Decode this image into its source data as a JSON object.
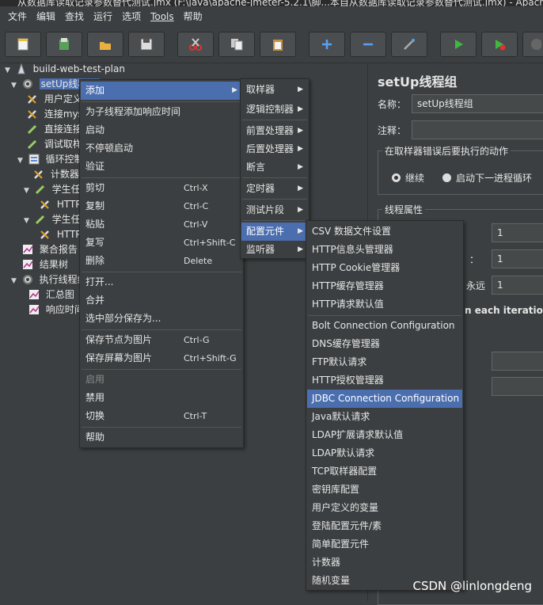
{
  "window": {
    "title": "从数据库读取记录参数替代测试.jmx (F:\\java\\apache-jmeter-5.2.1\\脚...本自从数据库读取记录参数替代测试.jmx) - Apache"
  },
  "menubar": [
    "文件",
    "编辑",
    "查找",
    "运行",
    "选项",
    "Tools",
    "帮助"
  ],
  "toolbar_icons": [
    "new-icon",
    "templates-icon",
    "open-icon",
    "save-icon",
    "cut-icon",
    "copy-icon",
    "paste-icon",
    "expand-icon",
    "collapse-icon",
    "toggle-icon",
    "start-icon",
    "start-no-pause-icon",
    "stop-icon"
  ],
  "tree": {
    "root": "build-web-test-plan",
    "nodes": [
      "setUp线程组",
      "用户定义",
      "连接mys",
      "直接连接",
      "调试取样",
      "循环控制",
      "计数器",
      "学生任",
      "HTTP",
      "学生任",
      "HTTP",
      "聚合报告",
      "结果树",
      "执行线程组",
      "汇总图",
      "响应时间"
    ]
  },
  "panel": {
    "title": "setUp线程组",
    "name_label": "名称：",
    "name_value": "setUp线程组",
    "comment_label": "注释：",
    "error_action_legend": "在取样器错误后要执行的动作",
    "radio_continue": "继续",
    "radio_next_loop": "启动下一进程循环",
    "thread_props_legend": "线程属性",
    "threads_value": "1",
    "rampup_label_tail": "：",
    "rampup_value": "1",
    "forever_label": "永远",
    "loop_value": "1",
    "same_user_tail": "n each iteration"
  },
  "context_menu": {
    "items": [
      {
        "label": "添加",
        "shortcut": "",
        "submenu": true,
        "highlight": true
      },
      {
        "label": "为子线程添加响应时间",
        "shortcut": ""
      },
      {
        "label": "启动",
        "shortcut": ""
      },
      {
        "label": "不停顿启动",
        "shortcut": ""
      },
      {
        "label": "验证",
        "shortcut": ""
      },
      {
        "label": "剪切",
        "shortcut": "Ctrl-X"
      },
      {
        "label": "复制",
        "shortcut": "Ctrl-C"
      },
      {
        "label": "粘贴",
        "shortcut": "Ctrl-V"
      },
      {
        "label": "复写",
        "shortcut": "Ctrl+Shift-C"
      },
      {
        "label": "删除",
        "shortcut": "Delete"
      },
      {
        "label": "打开...",
        "shortcut": ""
      },
      {
        "label": "合并",
        "shortcut": ""
      },
      {
        "label": "选中部分保存为...",
        "shortcut": ""
      },
      {
        "label": "保存节点为图片",
        "shortcut": "Ctrl-G"
      },
      {
        "label": "保存屏幕为图片",
        "shortcut": "Ctrl+Shift-G"
      },
      {
        "label": "启用",
        "shortcut": "",
        "disabled": true
      },
      {
        "label": "禁用",
        "shortcut": ""
      },
      {
        "label": "切换",
        "shortcut": "Ctrl-T"
      },
      {
        "label": "帮助",
        "shortcut": ""
      }
    ]
  },
  "add_submenu": {
    "items": [
      "取样器",
      "逻辑控制器",
      "前置处理器",
      "后置处理器",
      "断言",
      "定时器",
      "测试片段",
      "配置元件",
      "监听器"
    ],
    "highlight": "配置元件"
  },
  "config_submenu": {
    "items": [
      "CSV 数据文件设置",
      "HTTP信息头管理器",
      "HTTP Cookie管理器",
      "HTTP缓存管理器",
      "HTTP请求默认值",
      "Bolt Connection Configuration",
      "DNS缓存管理器",
      "FTP默认请求",
      "HTTP授权管理器",
      "JDBC Connection Configuration",
      "Java默认请求",
      "LDAP扩展请求默认值",
      "LDAP默认请求",
      "TCP取样器配置",
      "密钥库配置",
      "用户定义的变量",
      "登陆配置元件/素",
      "简单配置元件",
      "计数器",
      "随机变量"
    ],
    "highlight": "JDBC Connection Configuration"
  },
  "watermark": "CSDN @linlongdeng",
  "colors": {
    "background": "#3c3f41",
    "selection": "#4b6eaf",
    "text": "#e6e6e6"
  }
}
